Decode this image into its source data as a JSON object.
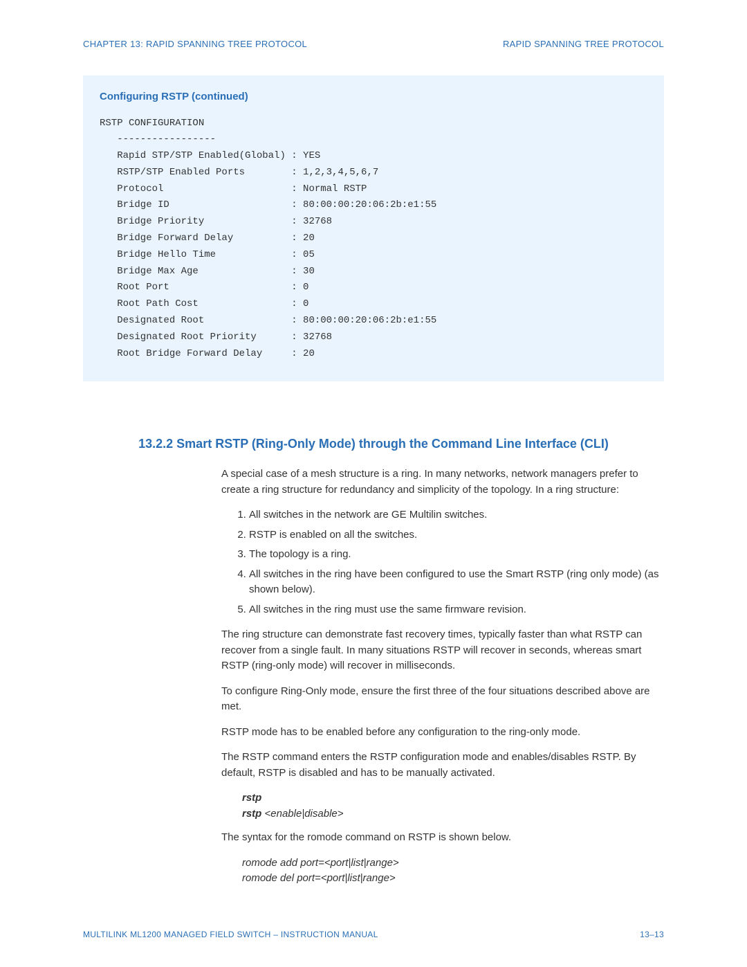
{
  "header": {
    "left": "CHAPTER 13: RAPID SPANNING TREE PROTOCOL",
    "right": "RAPID SPANNING TREE PROTOCOL"
  },
  "codebox": {
    "title": "Configuring RSTP (continued)",
    "intro": "RSTP CONFIGURATION",
    "divider": "   -----------------",
    "rows": [
      {
        "label": "   Rapid STP/STP Enabled(Global)",
        "value": "YES"
      },
      {
        "label": "   RSTP/STP Enabled Ports",
        "value": "1,2,3,4,5,6,7"
      },
      {
        "label": "   Protocol",
        "value": "Normal RSTP"
      },
      {
        "label": "   Bridge ID",
        "value": "80:00:00:20:06:2b:e1:55"
      },
      {
        "label": "   Bridge Priority",
        "value": "32768"
      },
      {
        "label": "   Bridge Forward Delay",
        "value": "20"
      },
      {
        "label": "   Bridge Hello Time",
        "value": "05"
      },
      {
        "label": "   Bridge Max Age",
        "value": "30"
      },
      {
        "label": "   Root Port",
        "value": "0"
      },
      {
        "label": "   Root Path Cost",
        "value": "0"
      },
      {
        "label": "   Designated Root",
        "value": "80:00:00:20:06:2b:e1:55"
      },
      {
        "label": "   Designated Root Priority",
        "value": "32768"
      },
      {
        "label": "   Root Bridge Forward Delay",
        "value": "20"
      }
    ]
  },
  "section": {
    "heading": "13.2.2   Smart RSTP (Ring-Only Mode) through the Command Line Interface (CLI)",
    "para1": "A special case of a mesh structure is a ring. In many networks, network managers prefer to create a ring structure for redundancy and simplicity of the topology. In a ring structure:",
    "list": [
      "All switches in the network are GE Multilin switches.",
      "RSTP is enabled on all the switches.",
      "The topology is a ring.",
      "All switches in the ring have been configured to use the Smart RSTP (ring only mode) (as shown below).",
      "All switches in the ring must use the same firmware revision."
    ],
    "para2": "The ring structure can demonstrate fast recovery times, typically faster than what RSTP can recover from a single fault. In many situations RSTP will recover in seconds, whereas smart RSTP (ring-only mode) will recover in milliseconds.",
    "para3": "To configure Ring-Only mode, ensure the first three of the four situations described above are met.",
    "para4": "RSTP mode has to be enabled before any configuration to the ring-only mode.",
    "para5": "The RSTP command enters the RSTP configuration mode and enables/disables RSTP.  By default, RSTP is disabled and has to be manually activated.",
    "cmd1a": "rstp",
    "cmd1b_bold": "rstp ",
    "cmd1b_italic": "<enable|disable>",
    "para6a": "The syntax for the ",
    "para6b": "romode",
    "para6c": " command on RSTP is shown below.",
    "cmd2a": "romode add port=<port|list|range>",
    "cmd2b": "romode del port=<port|list|range>"
  },
  "footer": {
    "left": "MULTILINK ML1200 MANAGED FIELD SWITCH – INSTRUCTION MANUAL",
    "right": "13–13"
  }
}
